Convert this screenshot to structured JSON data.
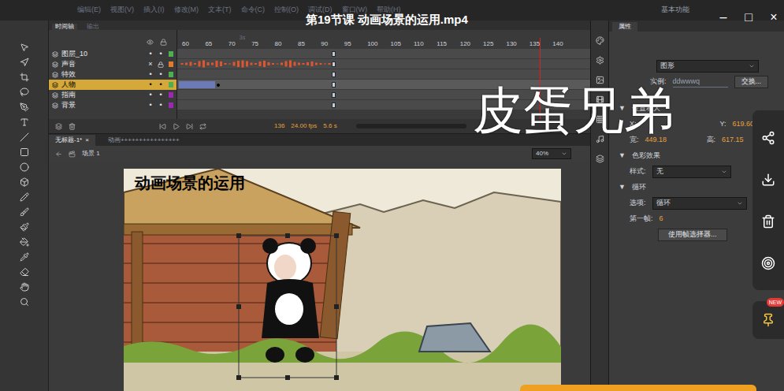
{
  "player": {
    "title": "第19节课 动画场景的运用.mp4",
    "window_controls": [
      "–",
      "□",
      "×"
    ],
    "watermark": "皮蛋兄弟",
    "badge": "NEW"
  },
  "app": {
    "menu": [
      "编辑(E)",
      "视图(V)",
      "插入(I)",
      "修改(M)",
      "文本(T)",
      "命令(C)",
      "控制(O)",
      "调试(D)",
      "窗口(W)",
      "帮助(H)"
    ],
    "workspace": "基本功能"
  },
  "timeline": {
    "tabs": [
      {
        "label": "时间轴",
        "selected": true
      },
      {
        "label": "输出",
        "selected": false
      }
    ],
    "ruler": [
      {
        "frame": "60",
        "second": ""
      },
      {
        "frame": "65",
        "second": ""
      },
      {
        "frame": "70",
        "second": "3s"
      },
      {
        "frame": "75",
        "second": ""
      },
      {
        "frame": "80",
        "second": ""
      },
      {
        "frame": "85",
        "second": ""
      },
      {
        "frame": "90",
        "second": ""
      },
      {
        "frame": "95",
        "second": ""
      },
      {
        "frame": "100",
        "second": ""
      },
      {
        "frame": "105",
        "second": ""
      },
      {
        "frame": "110",
        "second": ""
      },
      {
        "frame": "115",
        "second": ""
      },
      {
        "frame": "120",
        "second": ""
      },
      {
        "frame": "125",
        "second": ""
      },
      {
        "frame": "130",
        "second": ""
      },
      {
        "frame": "135",
        "second": ""
      },
      {
        "frame": "140",
        "second": ""
      }
    ],
    "layers": [
      {
        "name": "图层_10",
        "kind": "plain",
        "selected": false,
        "visible": true,
        "locked": false,
        "color": "#4caf50"
      },
      {
        "name": "声音",
        "kind": "audio",
        "selected": false,
        "visible": false,
        "locked": true,
        "color": "#e07a2e"
      },
      {
        "name": "特效",
        "kind": "plain",
        "selected": false,
        "visible": true,
        "locked": false,
        "color": "#4caf50"
      },
      {
        "name": "人物",
        "kind": "tween",
        "selected": true,
        "visible": true,
        "locked": false,
        "color": "#4caf50"
      },
      {
        "name": "指南",
        "kind": "plain",
        "selected": false,
        "visible": true,
        "locked": false,
        "color": "#9c27b0"
      },
      {
        "name": "背景",
        "kind": "plain",
        "selected": false,
        "visible": true,
        "locked": false,
        "color": "#9c27b0"
      }
    ],
    "current_frame": "136",
    "fps": "24.00 fps",
    "elapsed": "5.6 s"
  },
  "document": {
    "tabs": [
      {
        "label": "无标题-1*",
        "selected": true
      },
      {
        "label": "动画++++++++++++++++",
        "selected": false
      }
    ],
    "close": "×",
    "scene": "场景 1",
    "zoom": "40%",
    "stage_caption": "动画场景的运用"
  },
  "properties": {
    "tab": "属性",
    "type": "图形",
    "instance_label": "实例:",
    "instance": "ddwwwq",
    "swap": "交换...",
    "position_section": "位置和大",
    "x_label": "X:",
    "y_label": "Y:",
    "y": "619.60",
    "w_label": "宽:",
    "w": "449.18",
    "h_label": "高:",
    "h": "617.15",
    "color_section": "色彩效果",
    "style_label": "样式:",
    "style": "无",
    "loop_section": "循环",
    "option_label": "选项:",
    "option": "循环",
    "first_frame_label": "第一帧:",
    "first_frame": "6",
    "frame_picker": "使用帧选择器..."
  }
}
